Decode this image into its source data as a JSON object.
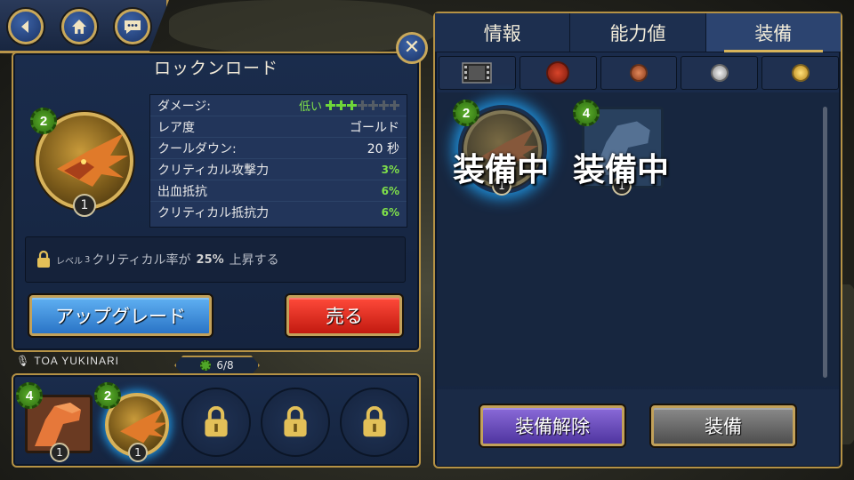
{
  "nav": {
    "back_icon": "back-arrow-icon",
    "home_icon": "home-icon",
    "chat_icon": "chat-bubble-icon"
  },
  "item": {
    "title": "ロックンロード",
    "gear_level": "2",
    "rank": "1"
  },
  "stats": {
    "damage_label": "ダメージ:",
    "damage_value": "低い",
    "damage_pips_on": 3,
    "damage_pips_total": 7,
    "rarity_label": "レア度",
    "rarity_value": "ゴールド",
    "cooldown_label": "クールダウン:",
    "cooldown_value": "20 秒",
    "crit_dmg_label": "クリティカル攻撃力",
    "crit_dmg_value": "3%",
    "bleed_res_label": "出血抵抗",
    "bleed_res_value": "6%",
    "crit_res_label": "クリティカル抵抗力",
    "crit_res_value": "6%"
  },
  "unlock": {
    "level_prefix": "レベル",
    "level_num": "3",
    "text_a": "クリティカル率が",
    "value": "25%",
    "text_b": "上昇する"
  },
  "buttons": {
    "upgrade": "アップグレード",
    "sell": "売る",
    "unequip": "装備解除",
    "equip": "装備"
  },
  "crew": {
    "name": "TOA YUKINARI",
    "counter": "6/8",
    "slots": [
      {
        "type": "card",
        "gear_level": "4",
        "rank": "1"
      },
      {
        "type": "medal",
        "gear_level": "2",
        "rank": "1"
      },
      {
        "type": "locked"
      },
      {
        "type": "locked"
      },
      {
        "type": "locked"
      }
    ]
  },
  "tabs": [
    {
      "label": "情報",
      "active": false
    },
    {
      "label": "能力値",
      "active": false
    },
    {
      "label": "装備",
      "active": true
    }
  ],
  "filters": [
    "film-icon",
    "red-medal-icon",
    "bronze-medal-icon",
    "silver-medal-icon",
    "gold-medal-icon"
  ],
  "equipped": {
    "overlay_text": "装備中",
    "items": [
      {
        "gear_level": "2",
        "rank": "1"
      },
      {
        "gear_level": "4",
        "rank": "1"
      }
    ]
  },
  "colors": {
    "panel": "#1a2c4c",
    "gold_border": "#b59245",
    "green_value": "#7fe04a",
    "upgrade_blue": "#2a74c6",
    "sell_red": "#c21a10",
    "unequip_purple": "#4f35a0",
    "equip_gray": "#4e4e4e"
  }
}
